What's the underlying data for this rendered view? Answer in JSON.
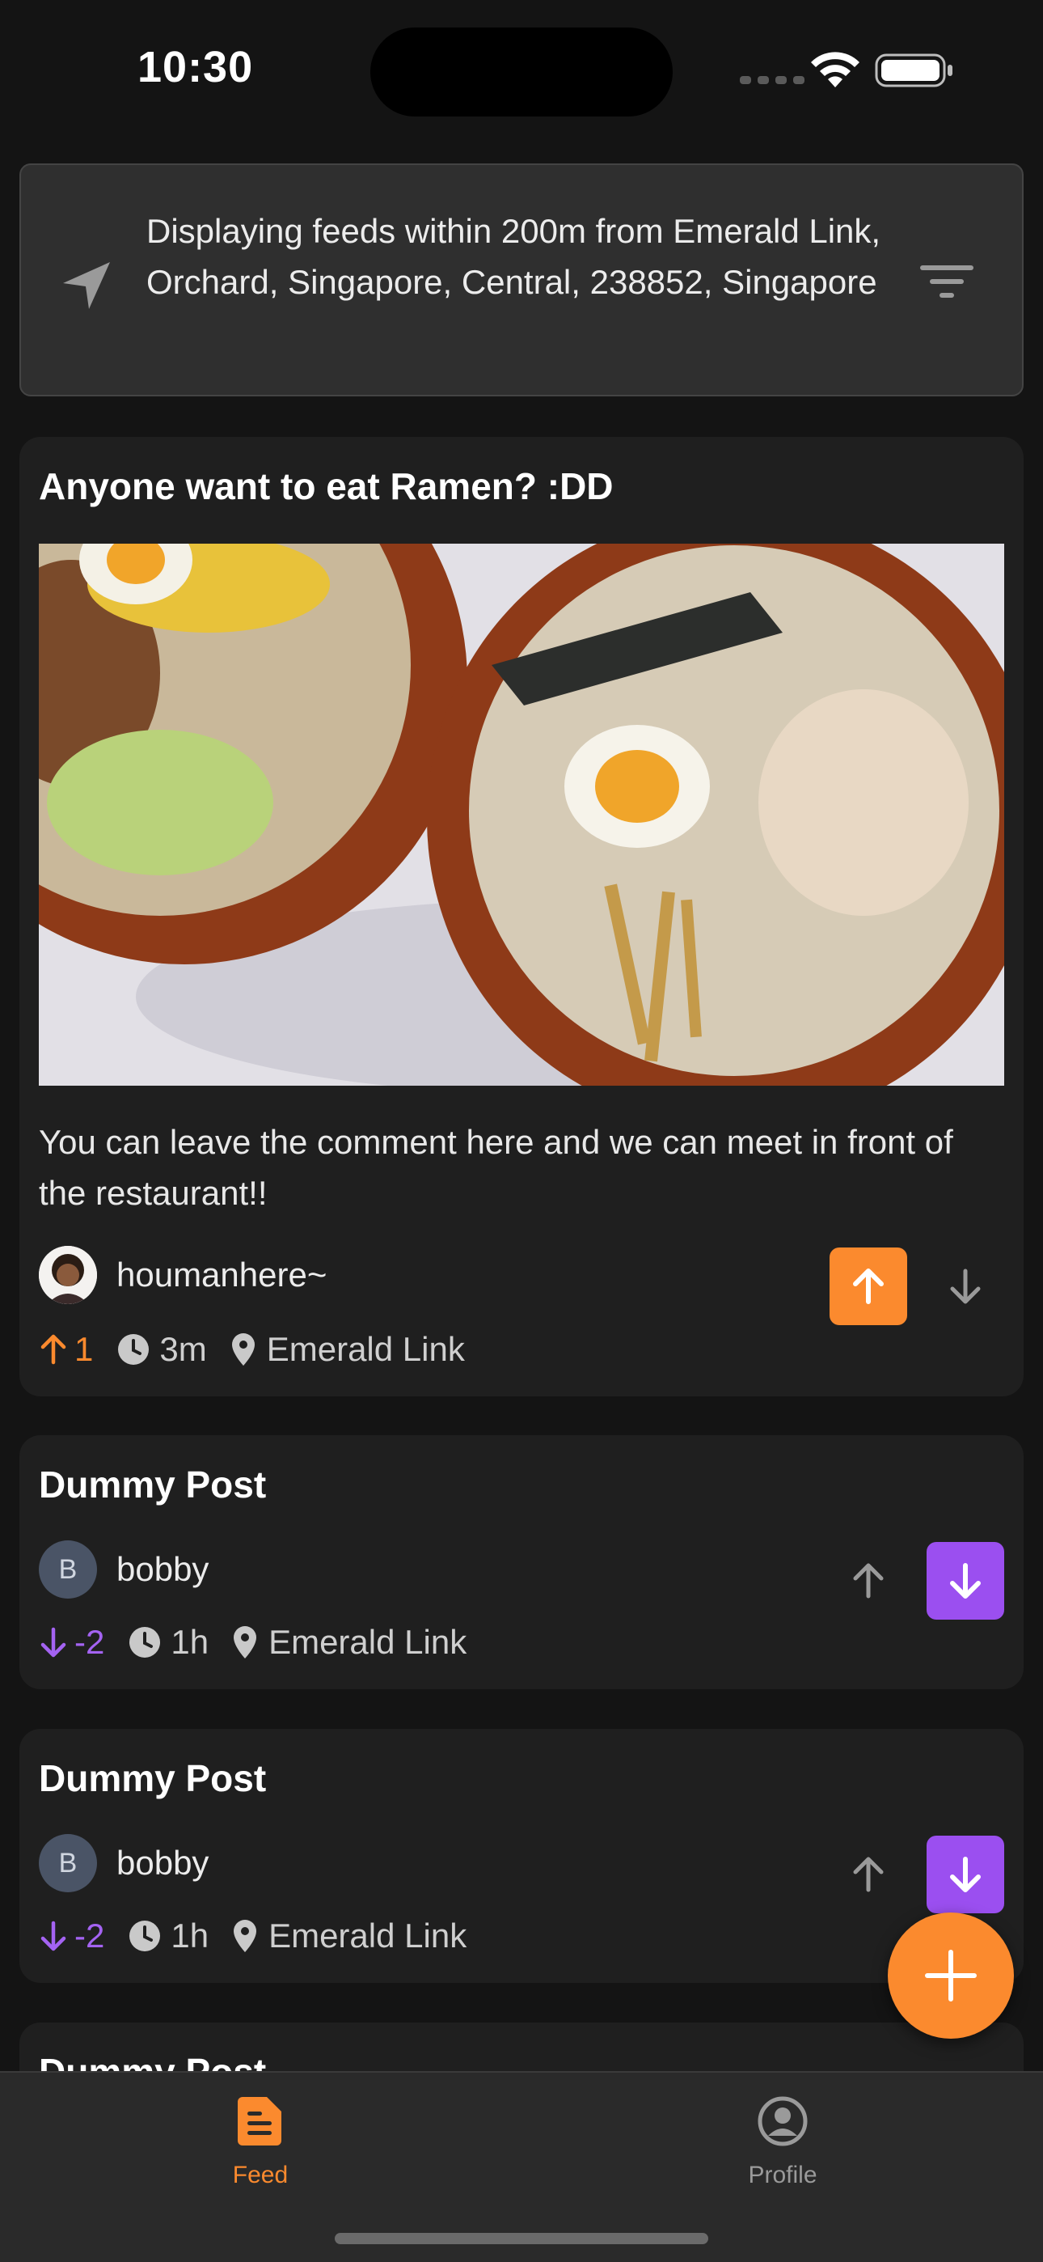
{
  "status_bar": {
    "time": "10:30"
  },
  "location_banner": {
    "text": "Displaying feeds within 200m from Emerald Link, Orchard, Singapore, Central, 238852, Singapore"
  },
  "posts": [
    {
      "title": "Anyone want to eat Ramen? :DD",
      "body": "You can leave the comment here and we can meet in front of the restaurant!!",
      "author": "houmanhere~",
      "score": "1",
      "time": "3m",
      "location": "Emerald Link",
      "vote_state": "up"
    },
    {
      "title": "Dummy Post",
      "author_initial": "B",
      "author": "bobby",
      "score": "-2",
      "time": "1h",
      "location": "Emerald Link",
      "vote_state": "down"
    },
    {
      "title": "Dummy Post",
      "author_initial": "B",
      "author": "bobby",
      "score": "-2",
      "time": "1h",
      "location": "Emerald Link",
      "vote_state": "down"
    },
    {
      "title": "Dummy Post"
    }
  ],
  "tabs": [
    {
      "label": "Feed",
      "icon": "feed-icon",
      "active": true
    },
    {
      "label": "Profile",
      "icon": "profile-icon",
      "active": false
    }
  ],
  "colors": {
    "accent_orange": "#fb8a2e",
    "accent_purple": "#9b4ff0",
    "card_bg": "#1f1f1f",
    "page_bg": "#141414"
  }
}
